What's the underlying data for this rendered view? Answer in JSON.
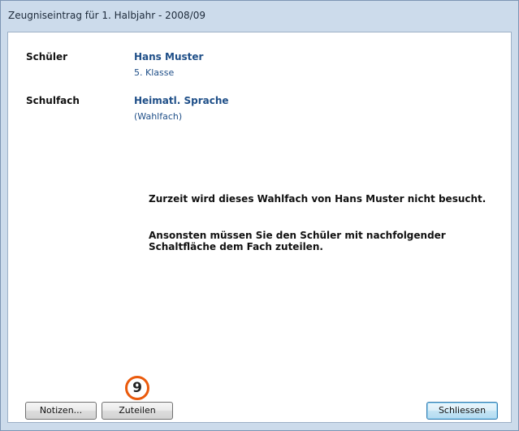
{
  "window": {
    "title": "Zeugniseintrag für 1. Halbjahr - 2008/09"
  },
  "student": {
    "label": "Schüler",
    "name": "Hans Muster",
    "class": "5. Klasse"
  },
  "subject": {
    "label": "Schulfach",
    "name": "Heimatl. Sprache",
    "type": "(Wahlfach)"
  },
  "message": {
    "line1": "Zurzeit wird dieses Wahlfach von Hans Muster nicht besucht.",
    "line2a": "Ansonsten müssen Sie den Schüler mit nachfolgender",
    "line2b": "Schaltfläche dem Fach zuteilen."
  },
  "buttons": {
    "notes": "Notizen...",
    "assign": "Zuteilen",
    "close": "Schliessen"
  },
  "callout": {
    "number": "9"
  },
  "colors": {
    "frame": "#ccdbeb",
    "link_blue": "#1f4f88",
    "callout_orange": "#ea5a0c"
  }
}
